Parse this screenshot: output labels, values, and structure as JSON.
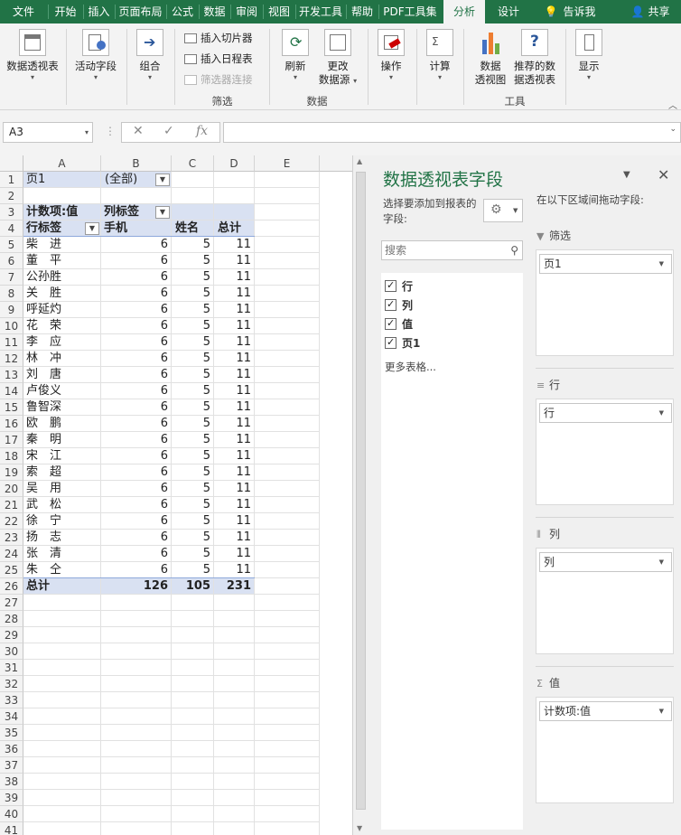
{
  "ribbon_tabs": [
    "文件",
    "开始",
    "插入",
    "页面布局",
    "公式",
    "数据",
    "审阅",
    "视图",
    "开发工具",
    "帮助",
    "PDF工具集",
    "分析",
    "设计"
  ],
  "ribbon_extra": {
    "tellme": "告诉我",
    "share": "共享"
  },
  "ribbon": {
    "pivottable": "数据透视表",
    "active_field": "活动字段",
    "group": "组合",
    "insert_slicer": "插入切片器",
    "insert_timeline": "插入日程表",
    "filter_connections": "筛选器连接",
    "group_filter": "筛选",
    "refresh": "刷新",
    "change_source_1": "更改",
    "change_source_2": "数据源",
    "group_data": "数据",
    "actions": "操作",
    "calculations": "计算",
    "pivotchart_1": "数据",
    "pivotchart_2": "透视图",
    "recommended_1": "推荐的数",
    "recommended_2": "据透视表",
    "group_tools": "工具",
    "show": "显示"
  },
  "formula_bar": {
    "name_box": "A3",
    "cancel": "✕",
    "enter": "✓",
    "fx": "fx",
    "formula": ""
  },
  "columns": [
    "A",
    "B",
    "C",
    "D",
    "E"
  ],
  "row_numbers": [
    "1",
    "2",
    "3",
    "4",
    "5",
    "6",
    "7",
    "8",
    "9",
    "10",
    "11",
    "12",
    "13",
    "14",
    "15",
    "16",
    "17",
    "18",
    "19",
    "20",
    "21",
    "22",
    "23",
    "24",
    "25",
    "26",
    "27",
    "28",
    "29",
    "30",
    "31",
    "32",
    "33",
    "34",
    "35",
    "36",
    "37",
    "38",
    "39",
    "40",
    "41"
  ],
  "pivot": {
    "page_field": "页1",
    "page_value": "(全部)",
    "count_label": "计数项:值",
    "col_label": "列标签",
    "row_label": "行标签",
    "col_headers": [
      "手机",
      "姓名",
      "总计"
    ],
    "rows": [
      {
        "name": "柴　进",
        "v": [
          "6",
          "5",
          "11"
        ]
      },
      {
        "name": "董　平",
        "v": [
          "6",
          "5",
          "11"
        ]
      },
      {
        "name": "公孙胜",
        "v": [
          "6",
          "5",
          "11"
        ]
      },
      {
        "name": "关　胜",
        "v": [
          "6",
          "5",
          "11"
        ]
      },
      {
        "name": "呼延灼",
        "v": [
          "6",
          "5",
          "11"
        ]
      },
      {
        "name": "花　荣",
        "v": [
          "6",
          "5",
          "11"
        ]
      },
      {
        "name": "李　应",
        "v": [
          "6",
          "5",
          "11"
        ]
      },
      {
        "name": "林　冲",
        "v": [
          "6",
          "5",
          "11"
        ]
      },
      {
        "name": "刘　唐",
        "v": [
          "6",
          "5",
          "11"
        ]
      },
      {
        "name": "卢俊义",
        "v": [
          "6",
          "5",
          "11"
        ]
      },
      {
        "name": "鲁智深",
        "v": [
          "6",
          "5",
          "11"
        ]
      },
      {
        "name": "欧　鹏",
        "v": [
          "6",
          "5",
          "11"
        ]
      },
      {
        "name": "秦　明",
        "v": [
          "6",
          "5",
          "11"
        ]
      },
      {
        "name": "宋　江",
        "v": [
          "6",
          "5",
          "11"
        ]
      },
      {
        "name": "索　超",
        "v": [
          "6",
          "5",
          "11"
        ]
      },
      {
        "name": "吴　用",
        "v": [
          "6",
          "5",
          "11"
        ]
      },
      {
        "name": "武　松",
        "v": [
          "6",
          "5",
          "11"
        ]
      },
      {
        "name": "徐　宁",
        "v": [
          "6",
          "5",
          "11"
        ]
      },
      {
        "name": "扬　志",
        "v": [
          "6",
          "5",
          "11"
        ]
      },
      {
        "name": "张　清",
        "v": [
          "6",
          "5",
          "11"
        ]
      },
      {
        "name": "朱　仝",
        "v": [
          "6",
          "5",
          "11"
        ]
      }
    ],
    "total_label": "总计",
    "totals": [
      "126",
      "105",
      "231"
    ]
  },
  "pane": {
    "title": "数据透视表字段",
    "choose_label": "选择要添加到报表的字段:",
    "search_placeholder": "搜索",
    "fields": [
      "行",
      "列",
      "值",
      "页1"
    ],
    "more_tables": "更多表格...",
    "drag_label": "在以下区域间拖动字段:",
    "areas": [
      {
        "name": "筛选",
        "icon": "filter-icon",
        "item": "页1"
      },
      {
        "name": "行",
        "icon": "rows-icon",
        "item": "行"
      },
      {
        "name": "列",
        "icon": "columns-icon",
        "item": "列"
      },
      {
        "name": "值",
        "icon": "sigma-icon",
        "item": "计数项:值"
      }
    ]
  },
  "colors": {
    "accent": "#217346",
    "pivot_band": "#d9e1f2"
  }
}
